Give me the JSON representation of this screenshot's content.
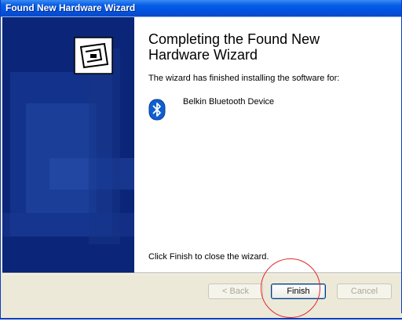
{
  "window": {
    "title": "Found New Hardware Wizard"
  },
  "content": {
    "heading": "Completing the Found New Hardware Wizard",
    "finished_text": "The wizard has finished installing the software for:",
    "device_name": "Belkin Bluetooth Device",
    "close_text": "Click Finish to close the wizard."
  },
  "buttons": {
    "back_label": "< Back",
    "finish_label": "Finish",
    "cancel_label": "Cancel"
  },
  "icons": {
    "banner": "hardware-wizard-icon",
    "device": "bluetooth-icon"
  },
  "colors": {
    "title_bar": "#0054e3",
    "banner": "#0b2678",
    "callout": "#e0282d"
  }
}
